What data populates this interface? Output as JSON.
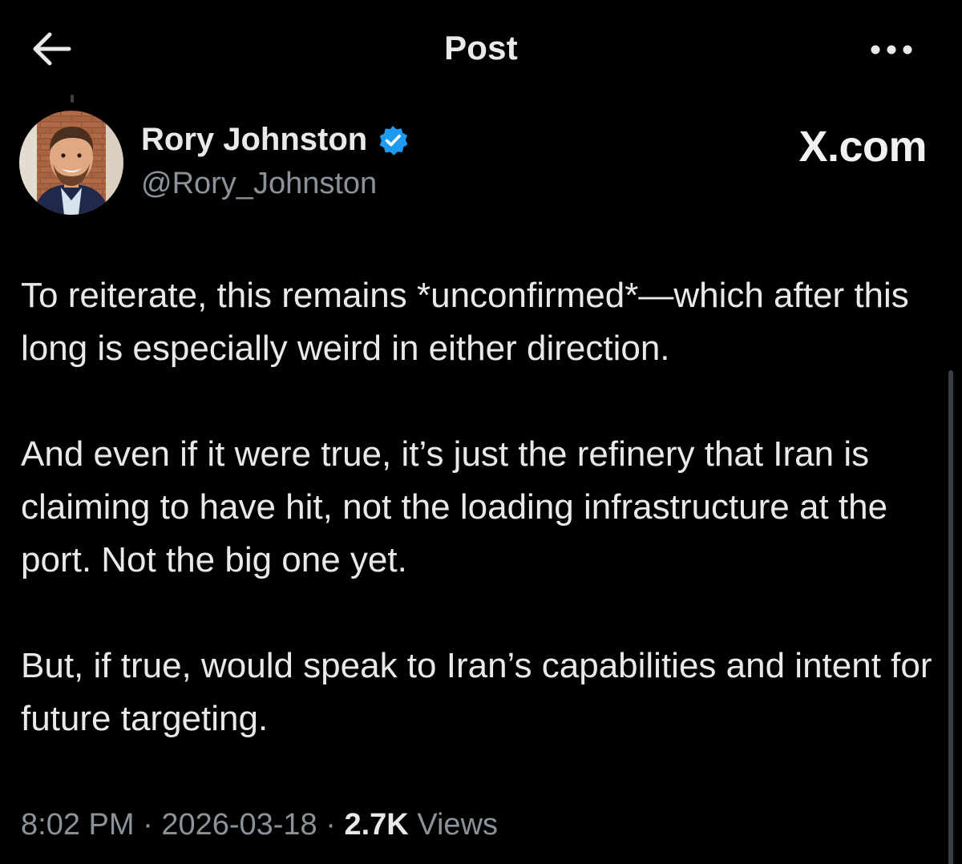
{
  "header": {
    "title": "Post",
    "back_icon": "arrow-left-icon",
    "more_icon": "more-horizontal-icon"
  },
  "author": {
    "name": "Rory Johnston",
    "handle": "@Rory_Johnston",
    "verified_icon": "verified-badge-icon",
    "verified_color": "#1d9bf0"
  },
  "brand": {
    "text": "X.com"
  },
  "post": {
    "paragraphs": [
      "To reiterate, this remains *unconfirmed*—which after this long is especially weird in either direction.",
      "And even if it were true, it’s just the refinery that Iran is claiming to have hit, not the loading infrastructure at the port. Not the big one yet.",
      "But, if true, would speak to Iran’s capabilities and intent for future targeting."
    ]
  },
  "meta": {
    "time": "8:02 PM",
    "separator": " · ",
    "date": "2026-03-18",
    "views_count": "2.7K",
    "views_label": "Views"
  },
  "colors": {
    "background": "#000000",
    "text_primary": "#e7e9ea",
    "text_secondary": "#8b9299",
    "accent": "#1d9bf0"
  }
}
